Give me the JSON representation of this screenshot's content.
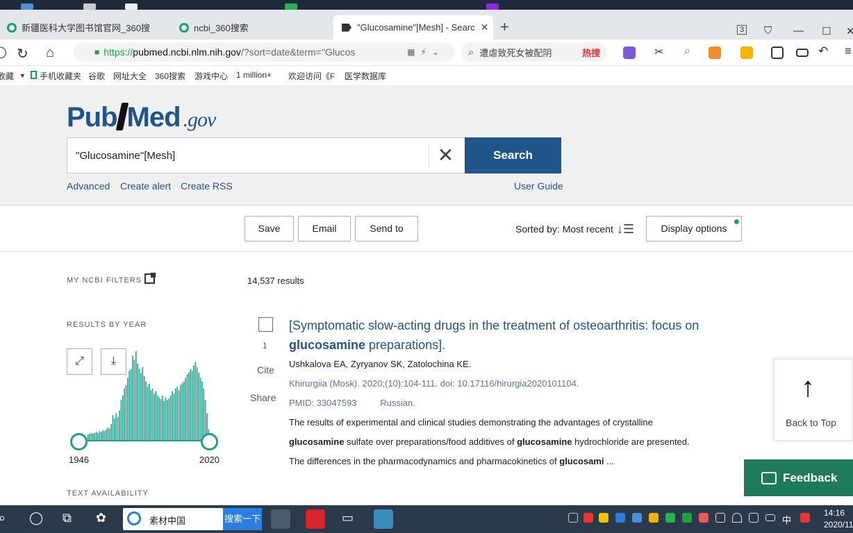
{
  "browser": {
    "tabs": [
      {
        "label": "新疆医科大学图书馆官网_360搜"
      },
      {
        "label": "ncbi_360搜索"
      },
      {
        "label": "\"Glucosamine\"[Mesh] - Searc"
      }
    ],
    "tab_count_badge": "3",
    "url": {
      "protocol": "https://",
      "host": "pubmed.ncbi.nlm.nih.gov",
      "rest": "/?sort=date&term=\"Glucos"
    },
    "side_search": {
      "text": "遭虐致死女被配阴",
      "hot_label": "热搜"
    },
    "bookmarks": [
      "收藏",
      "手机收藏夹",
      "谷歌",
      "网址大全",
      "360搜索",
      "游戏中心",
      "1 million+",
      "欢迎访问《F",
      "医学数据库"
    ]
  },
  "header": {
    "logo_main": "PubMed",
    "logo_suffix": ".gov",
    "query": "\"Glucosamine\"[Mesh]",
    "search_label": "Search",
    "links": {
      "advanced": "Advanced",
      "create_alert": "Create alert",
      "create_rss": "Create RSS",
      "user_guide": "User Guide"
    }
  },
  "actions": {
    "save": "Save",
    "email": "Email",
    "send_to": "Send to",
    "sorted_by": "Sorted by: Most recent",
    "display_options": "Display options"
  },
  "sidebar": {
    "filters_heading": "MY NCBI FILTERS",
    "results_by_year_heading": "RESULTS BY YEAR",
    "year_start": "1946",
    "year_end": "2020",
    "text_availability_heading": "TEXT AVAILABILITY",
    "histogram_heights": [
      0.06,
      0.07,
      0.08,
      0.07,
      0.08,
      0.09,
      0.08,
      0.1,
      0.09,
      0.11,
      0.1,
      0.12,
      0.14,
      0.13,
      0.18,
      0.28,
      0.24,
      0.3,
      0.26,
      0.33,
      0.45,
      0.5,
      0.58,
      0.62,
      0.7,
      0.78,
      0.8,
      0.95,
      0.9,
      1.0,
      0.86,
      0.8,
      0.75,
      0.82,
      0.72,
      0.66,
      0.6,
      0.63,
      0.56,
      0.58,
      0.52,
      0.55,
      0.5,
      0.48,
      0.46,
      0.5,
      0.44,
      0.48,
      0.45,
      0.47,
      0.5,
      0.55,
      0.52,
      0.58,
      0.6,
      0.56,
      0.62,
      0.64,
      0.66,
      0.7,
      0.74,
      0.76,
      0.8,
      0.78,
      0.84,
      0.88,
      0.82,
      0.76,
      0.7,
      0.66,
      0.58,
      0.45,
      0.3,
      0.12
    ]
  },
  "results": {
    "count": "14,537 results",
    "items": [
      {
        "number": "1",
        "title_pre": "[Symptomatic slow-acting drugs in the treatment of osteoarthritis: focus on",
        "title_bold": "glucosamine",
        "title_post": " preparations].",
        "authors": "Ushkalova EA, Zyryanov SK, Zatolochina KE.",
        "citation": "Khirurgiia (Mosk). 2020;(10):104-111. doi: 10.17116/hirurgia2020101104.",
        "pmid": "PMID: 33047593",
        "language": "Russian.",
        "cite": "Cite",
        "share": "Share",
        "snippet": {
          "line1": "The results of experimental and clinical studies demonstrating the advantages of crystalline",
          "line2_b1": "glucosamine",
          "line2_t1": " sulfate over preparations/food additives of ",
          "line2_b2": "glucosamine",
          "line2_t2": " hydrochloride are presented.",
          "line3_t": "The differences in the pharmacodynamics and pharmacokinetics of ",
          "line3_b": "glucosami",
          "line3_e": " ..."
        }
      }
    ]
  },
  "floating": {
    "back_to_top": "Back to Top",
    "feedback": "Feedback"
  },
  "taskbar": {
    "search_text": "素材中国",
    "search_button": "搜索一下",
    "time": "14:16",
    "date": "2020/11"
  },
  "colors": {
    "pubmed_blue": "#20558a",
    "histogram_teal": "#1f9e8c",
    "feedback_green": "#1d7a5a"
  }
}
